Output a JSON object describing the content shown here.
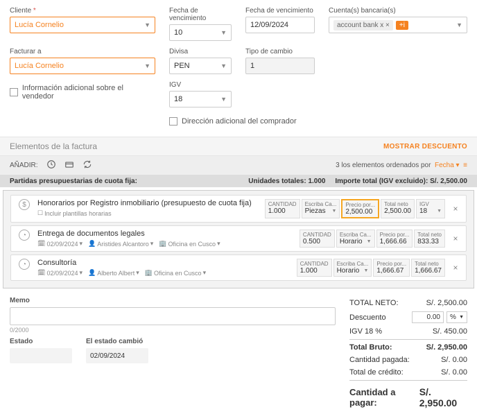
{
  "header": {
    "client_label": "Cliente",
    "client_value": "Lucía Cornelio",
    "due_label": "Fecha de vencimiento",
    "due_day": "10",
    "due_date": "12/09/2024",
    "accounts_label": "Cuenta(s) bancaria(s)",
    "account_text": "account bank x",
    "account_extra": "+i",
    "billto_label": "Facturar a",
    "billto_value": "Lucía Cornelio",
    "currency_label": "Divisa",
    "currency_value": "PEN",
    "rate_label": "Tipo de cambio",
    "rate_value": "1",
    "seller_info": "Información adicional sobre el vendedor",
    "igv_label": "IGV",
    "igv_value": "18",
    "buyer_addr": "Dirección adicional del comprador"
  },
  "section": {
    "title": "Elementos de la factura",
    "show_discount": "MOSTRAR DESCUENTO"
  },
  "addbar": {
    "label": "AÑADIR:",
    "sort_prefix": "3 los elementos ordenados por",
    "sort_field": "Fecha"
  },
  "budget": {
    "title": "Partidas presupuestarias de cuota fija:",
    "units_label": "Unidades totales:",
    "units_value": "1.000",
    "import_label": "Importe total (IGV excluido):",
    "import_value": "S/. 2,500.00"
  },
  "fields": {
    "qty": "CANTIDAD",
    "writeqty": "Escriba Ca...",
    "priceper": "Precio por...",
    "totalnet": "Total neto",
    "igv": "IGV",
    "hourly": "Horario"
  },
  "lines": [
    {
      "title": "Honorarios por Registro inmobiliario (presupuesto de cuota fija)",
      "sub": "Incluir plantillas horarias",
      "qty": "1.000",
      "unit": "Piezas",
      "price": "2,500.00",
      "net": "2,500.00",
      "igv": "18",
      "type": "dollar"
    },
    {
      "title": "Entrega de documentos legales",
      "date": "02/09/2024",
      "person": "Aristides Alcantoro",
      "office": "Oficina en Cusco",
      "qty": "0.500",
      "unit": "Horario",
      "price": "1,666.66",
      "net": "833.33",
      "type": "clock"
    },
    {
      "title": "Consultoría",
      "date": "02/09/2024",
      "person": "Alberto Albert",
      "office": "Oficina en Cusco",
      "qty": "1.000",
      "unit": "Horario",
      "price": "1,666.67",
      "net": "1,666.67",
      "type": "clock"
    }
  ],
  "memo": {
    "label": "Memo",
    "count": "0/2000",
    "state_label": "Estado",
    "changed_label": "El estado cambió",
    "changed_value": "02/09/2024"
  },
  "totals": {
    "net_label": "TOTAL NETO:",
    "net_value": "S/. 2,500.00",
    "disc_label": "Descuento",
    "disc_value": "0.00",
    "disc_unit": "%",
    "igv_label": "IGV 18 %",
    "igv_value": "S/. 450.00",
    "gross_label": "Total Bruto:",
    "gross_value": "S/. 2,950.00",
    "paid_label": "Cantidad pagada:",
    "paid_value": "S/. 0.00",
    "credit_label": "Total de crédito:",
    "credit_value": "S/. 0.00",
    "due_label": "Cantidad a pagar:",
    "due_value": "S/. 2,950.00"
  }
}
